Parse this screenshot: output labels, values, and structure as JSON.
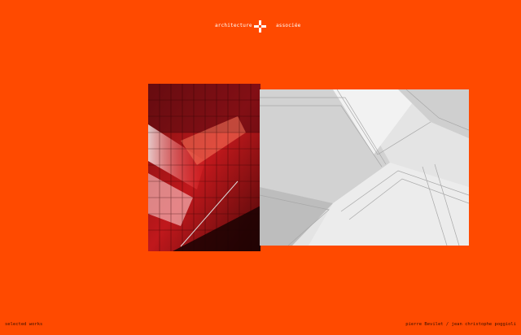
{
  "header": {
    "left_label": "architecture",
    "right_label": "associée",
    "logo_icon": "cross-pinwheel-icon"
  },
  "gallery": {
    "images": [
      {
        "description_icon": "red-glowing-grid-staircase-photo"
      },
      {
        "description_icon": "white-folded-ceiling-photo"
      }
    ]
  },
  "footer": {
    "left_link": "selected works",
    "right_link": "pierre Bevilet / jean christophe poggioli"
  },
  "colors": {
    "background": "#ff4a00",
    "header_text": "#ffffff",
    "footer_text": "#3a1000"
  }
}
